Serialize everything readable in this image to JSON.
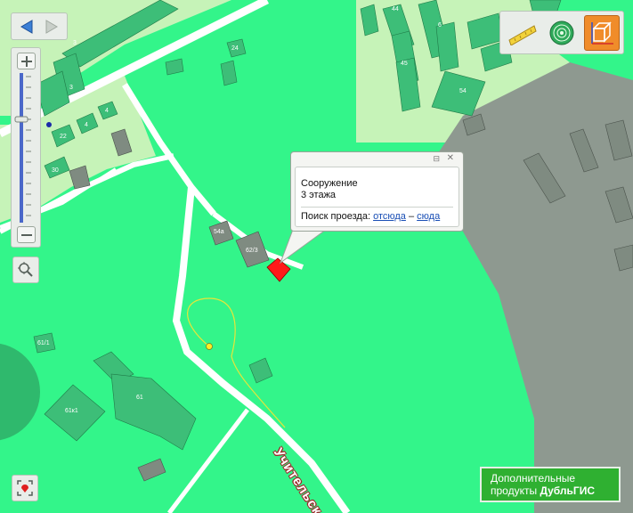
{
  "popup": {
    "title": "Сооружение",
    "floors": "3 этажа",
    "route_label": "Поиск проезда:",
    "from_link": "отсюда",
    "dash": "–",
    "to_link": "сюда"
  },
  "street_name": "Учительск",
  "promo": {
    "line1": "Дополнительные",
    "line2_prefix": "продукты",
    "brand": "ДубльГИС"
  },
  "building_labels": [
    "3",
    "3",
    "4",
    "4",
    "6",
    "24",
    "22",
    "30",
    "45",
    "54",
    "61",
    "61к1",
    "61/1",
    "54а",
    "62/3"
  ],
  "colors": {
    "park": "#33f58a",
    "residential": "#c6f3b8",
    "industrial": "#8e9990",
    "road": "#ffffff",
    "building": "#3dbe78",
    "building_dark": "#7f8b81",
    "selected": "#ff1a1a",
    "promo_bg": "#2fb031"
  },
  "icons": [
    "back-arrow-icon",
    "forward-arrow-icon",
    "zoom-in-icon",
    "zoom-out-icon",
    "zoom-fit-icon",
    "ruler-icon",
    "radar-icon",
    "3d-box-icon",
    "locate-icon"
  ]
}
